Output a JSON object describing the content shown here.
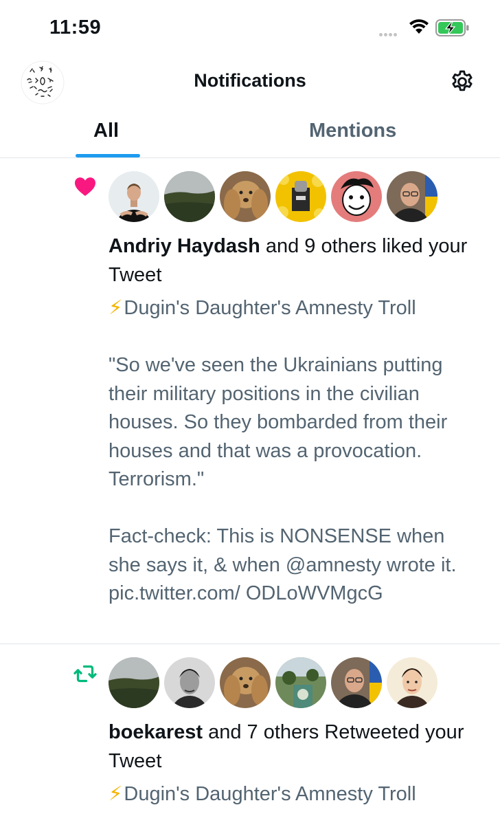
{
  "status_bar": {
    "time": "11:59"
  },
  "header": {
    "title": "Notifications"
  },
  "tabs": [
    {
      "label": "All",
      "selected": true
    },
    {
      "label": "Mentions",
      "selected": false
    }
  ],
  "colors": {
    "accent": "#1d9bf0",
    "like": "#f91880",
    "retweet": "#00ba7c",
    "secondary_text": "#536471"
  },
  "notifications": [
    {
      "type": "like",
      "icon": "heart-icon",
      "actor": "Andriy Haydash",
      "action": " and 9 others liked your Tweet",
      "tweet_title_icon": "⚡",
      "tweet_title": "Dugin's Daughter's Amnesty Troll",
      "tweet_paragraphs": [
        "\"So we've seen the Ukrainians putting their military positions in the civilian houses. So they bombarded from their houses and that was a provocation. Terrorism.\"",
        "Fact-check: This is NONSENSE when she says it, & when @amnesty wrote it. pic.twitter.com/ ODLoWVMgcG"
      ]
    },
    {
      "type": "retweet",
      "icon": "retweet-icon",
      "actor": "boekarest",
      "action": " and 7 others Retweeted your Tweet",
      "tweet_title_icon": "⚡",
      "tweet_title": "Dugin's Daughter's Amnesty Troll"
    }
  ]
}
